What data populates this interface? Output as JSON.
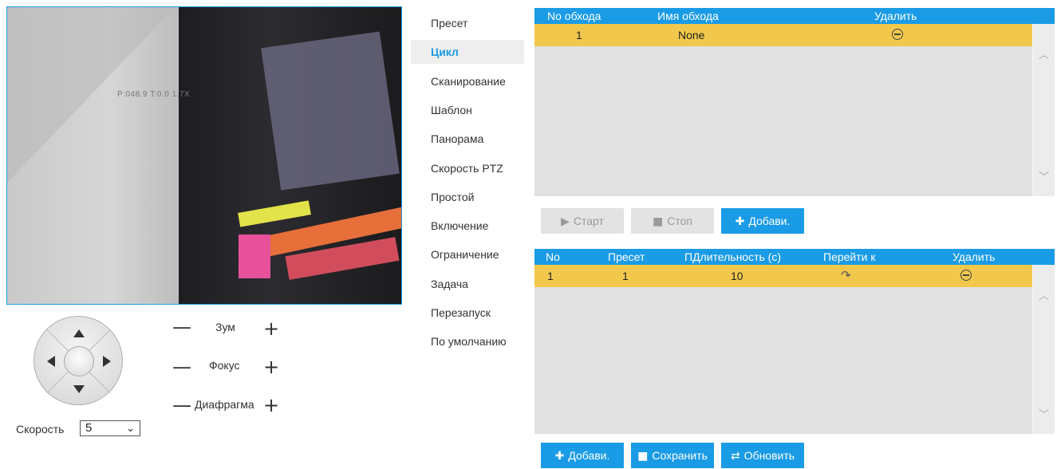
{
  "video": {
    "osd_text": "P:048.9 T:0.0 1.7X"
  },
  "ptz": {
    "zoom_label": "Зум",
    "focus_label": "Фокус",
    "iris_label": "Диафрагма",
    "minus": "—",
    "plus": "+",
    "speed_label": "Скорость",
    "speed_value": "5"
  },
  "menu": {
    "items": [
      "Пресет",
      "Цикл",
      "Сканирование",
      "Шаблон",
      "Панорама",
      "Скорость PTZ",
      "Простой",
      "Включение",
      "Ограничение",
      "Задача",
      "Перезапуск",
      "По умолчанию"
    ],
    "active_index": 1
  },
  "patrol_table": {
    "headers": [
      "No обхода",
      "Имя обхода",
      "Удалить"
    ],
    "rows": [
      {
        "no": "1",
        "name": "None"
      }
    ]
  },
  "patrol_buttons": {
    "start": "Старт",
    "stop": "Стоп",
    "add": "Добави."
  },
  "preset_table": {
    "headers": [
      "No",
      "Пресет",
      "ПДлительность (с)",
      "Перейти к",
      "Удалить"
    ],
    "rows": [
      {
        "no": "1",
        "preset": "1",
        "duration": "10"
      }
    ]
  },
  "bottom_buttons": {
    "add": "Добави.",
    "save": "Сохранить",
    "refresh": "Обновить"
  },
  "colors": {
    "accent": "#1a9be6",
    "row_highlight": "#f1c84b",
    "table_bg": "#e1e1e1"
  }
}
